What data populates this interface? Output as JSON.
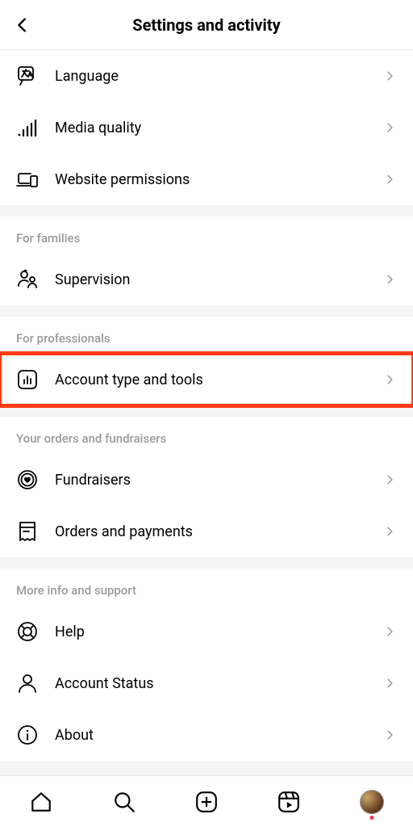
{
  "header": {
    "title": "Settings and activity"
  },
  "groups": {
    "top": {
      "language": "Language",
      "media_quality": "Media quality",
      "website_permissions": "Website permissions"
    },
    "families": {
      "heading": "For families",
      "supervision": "Supervision"
    },
    "professionals": {
      "heading": "For professionals",
      "account_type_tools": "Account type and tools"
    },
    "orders": {
      "heading": "Your orders and fundraisers",
      "fundraisers": "Fundraisers",
      "orders_payments": "Orders and payments"
    },
    "more": {
      "heading": "More info and support",
      "help": "Help",
      "account_status": "Account Status",
      "about": "About"
    }
  }
}
